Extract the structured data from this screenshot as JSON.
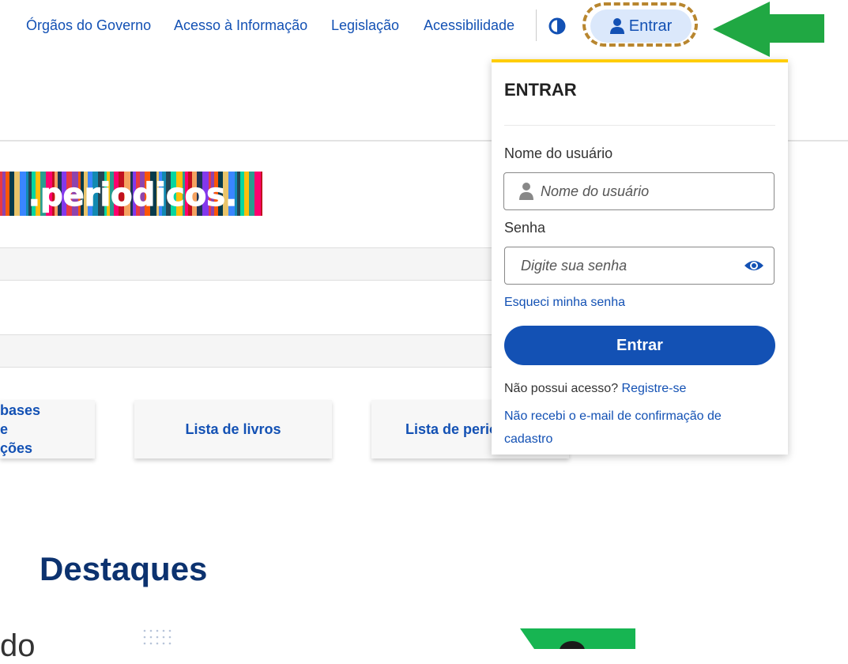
{
  "topnav": {
    "links": [
      "Órgãos do Governo",
      "Acesso à Informação",
      "Legislação",
      "Acessibilidade"
    ],
    "login_label": "Entrar"
  },
  "logo": {
    "text": ".periodicos."
  },
  "cards": [
    "bases e\nções",
    "Lista de livros",
    "Lista de periódicos"
  ],
  "main": {
    "section_title": "Destaques",
    "cut_text": "do"
  },
  "login_panel": {
    "title": "ENTRAR",
    "username_label": "Nome do usuário",
    "username_placeholder": "Nome do usuário",
    "password_label": "Senha",
    "password_placeholder": "Digite sua senha",
    "forgot_link": "Esqueci minha senha",
    "submit_label": "Entrar",
    "no_access_text": "Não possui acesso?",
    "register_link": "Registre-se",
    "no_email_link": "Não recebi o e-mail de confirmação de cadastro"
  },
  "colors": {
    "primary": "#1351b4",
    "accent_yellow": "#ffcd07",
    "arrow_green": "#20a843",
    "title_navy": "#0c326f"
  }
}
